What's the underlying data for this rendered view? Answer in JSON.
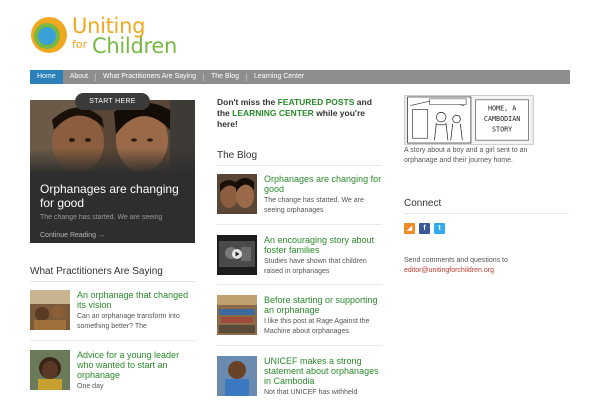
{
  "logo": {
    "line1": "Uniting",
    "line2": "for",
    "line3": "Children",
    "colors": {
      "orange": "#f0a820",
      "green": "#78b842",
      "blue": "#3aa0d8"
    }
  },
  "nav": {
    "items": [
      {
        "label": "Home",
        "active": true
      },
      {
        "label": "About",
        "active": false
      },
      {
        "label": "What Practitioners Are Saying",
        "active": false
      },
      {
        "label": "The Blog",
        "active": false
      },
      {
        "label": "Learning Center",
        "active": false
      }
    ],
    "bar_color": "#8e8e8e",
    "active_color": "#2b80b9"
  },
  "slider": {
    "start_label": "START HERE",
    "title": "Orphanages are changing for good",
    "excerpt": "The change has started. We are seeing",
    "link": "Continue Reading →"
  },
  "practitioners": {
    "heading": "What Practitioners Are Saying",
    "posts": [
      {
        "title": "An orphanage that changed its vision",
        "excerpt": "Can an orphanage transform into something better? The"
      },
      {
        "title": "Advice for a young leader who wanted to start an orphanage",
        "excerpt": "One day"
      }
    ]
  },
  "promo": {
    "part1": "Don't miss the ",
    "featured": "FEATURED POSTS",
    "part2": " and the ",
    "learning": "LEARNING CENTER",
    "part3": " while you're here!"
  },
  "blog": {
    "heading": "The Blog",
    "posts": [
      {
        "title": "Orphanages are changing for good",
        "excerpt": "The change has started. We are seeing orphanages"
      },
      {
        "title": "An encouraging story about foster families",
        "excerpt": "Studies have shown that children raised in orphanages"
      },
      {
        "title": "Before starting or supporting an orphanage",
        "excerpt": "I like this post at Rage Against the Machine about orphanages."
      },
      {
        "title": "UNICEF makes a strong statement about orphanages in Cambodia",
        "excerpt": "Not that UNICEF has withheld"
      }
    ]
  },
  "sidebar": {
    "cartoon_title_1": "HOME, A",
    "cartoon_title_2": "CAMBODIAN",
    "cartoon_title_3": "STORY",
    "cartoon_caption": "A story about a boy and a girl sent to an orphanage and their journey home.",
    "connect_heading": "Connect",
    "social": [
      {
        "icon": "rss-icon",
        "glyph": "◢",
        "color": "#f08a24"
      },
      {
        "icon": "facebook-icon",
        "glyph": "f",
        "color": "#3b5998"
      },
      {
        "icon": "twitter-icon",
        "glyph": "t",
        "color": "#33aaee"
      }
    ],
    "contact_text": "Send comments and questions to",
    "contact_email": "editor@unitingforchildren.org"
  }
}
